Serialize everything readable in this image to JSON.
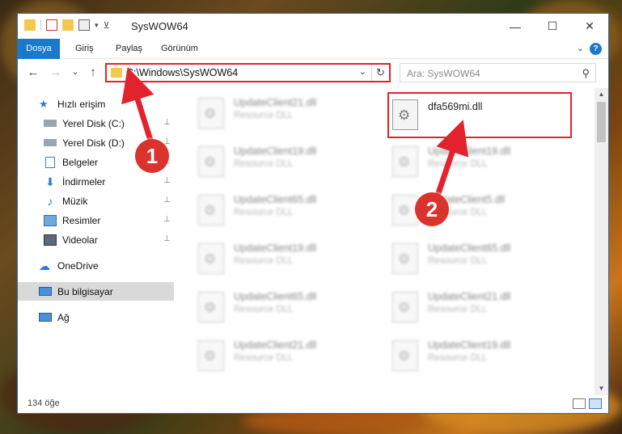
{
  "window": {
    "title": "SysWOW64",
    "minimize_glyph": "—",
    "maximize_glyph": "☐",
    "close_glyph": "✕"
  },
  "ribbon": {
    "tabs": [
      "Dosya",
      "Giriş",
      "Paylaş",
      "Görünüm"
    ],
    "help_glyph": "?",
    "expand_glyph": "⌄"
  },
  "nav": {
    "back_glyph": "←",
    "forward_glyph": "→",
    "recent_glyph": "⌄",
    "up_glyph": "↑",
    "address": "C:\\Windows\\SysWOW64",
    "address_drop_glyph": "⌄",
    "refresh_glyph": "↻",
    "search_placeholder": "Ara: SysWOW64",
    "search_glyph": "⚲"
  },
  "sidebar": {
    "items": [
      {
        "label": "Hızlı erişim",
        "icon": "star-icon",
        "pinned": false
      },
      {
        "label": "Yerel Disk (C:)",
        "icon": "drive-icon",
        "pinned": true
      },
      {
        "label": "Yerel Disk (D:)",
        "icon": "drive-icon",
        "pinned": true
      },
      {
        "label": "Belgeler",
        "icon": "documents-icon",
        "pinned": true
      },
      {
        "label": "İndirmeler",
        "icon": "download-icon",
        "pinned": true
      },
      {
        "label": "Müzik",
        "icon": "music-icon",
        "pinned": true
      },
      {
        "label": "Resimler",
        "icon": "pictures-icon",
        "pinned": true
      },
      {
        "label": "Videolar",
        "icon": "videos-icon",
        "pinned": true
      },
      {
        "label": "OneDrive",
        "icon": "cloud-icon",
        "pinned": false
      },
      {
        "label": "Bu bilgisayar",
        "icon": "computer-icon",
        "pinned": false
      },
      {
        "label": "Ağ",
        "icon": "network-icon",
        "pinned": false
      }
    ],
    "pin_glyph": "📌"
  },
  "files": {
    "left_column": [
      {
        "name": "UpdateClient21.dll",
        "type": "Resource DLL"
      },
      {
        "name": "UpdateClient19.dll",
        "type": "Resource DLL"
      },
      {
        "name": "UpdateClient65.dll",
        "type": "Resource DLL"
      },
      {
        "name": "UpdateClient19.dll",
        "type": "Resource DLL"
      },
      {
        "name": "UpdateClient65.dll",
        "type": "Resource DLL"
      },
      {
        "name": "UpdateClient21.dll",
        "type": "Resource DLL"
      }
    ],
    "right_column": [
      {
        "name": "dfa569mi.dll",
        "type": ""
      },
      {
        "name": "UpdateClient19.dll",
        "type": "Resource DLL"
      },
      {
        "name": "UpdateClient5.dll",
        "type": "Resource DLL"
      },
      {
        "name": "UpdateClient65.dll",
        "type": "Resource DLL"
      },
      {
        "name": "UpdateClient21.dll",
        "type": "Resource DLL"
      },
      {
        "name": "UpdateClient19.dll",
        "type": "Resource DLL"
      }
    ]
  },
  "status": {
    "item_count": "134 öğe"
  },
  "annotations": {
    "callout_1": "1",
    "callout_2": "2",
    "color": "#e2232e"
  },
  "scroll": {
    "up_glyph": "▲",
    "down_glyph": "▼"
  }
}
